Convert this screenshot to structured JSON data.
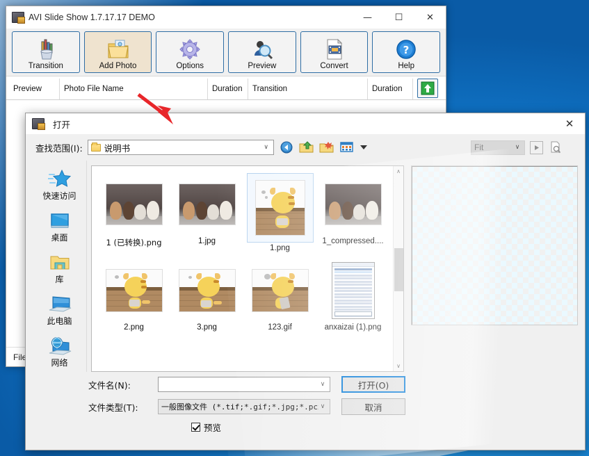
{
  "app": {
    "title": "AVI Slide Show 1.7.17.17 DEMO",
    "icon": "app-icon",
    "window_controls": {
      "minimize": "—",
      "maximize": "☐",
      "close": "✕"
    },
    "toolbar": [
      {
        "label": "Transition",
        "icon": "pencil-cup-icon",
        "active": false
      },
      {
        "label": "Add Photo",
        "icon": "add-photo-folder-icon",
        "active": true
      },
      {
        "label": "Options",
        "icon": "gear-icon",
        "active": false
      },
      {
        "label": "Preview",
        "icon": "magnifier-person-icon",
        "active": false
      },
      {
        "label": "Convert",
        "icon": "film-document-icon",
        "active": false
      },
      {
        "label": "Help",
        "icon": "question-mark-icon",
        "active": false
      }
    ],
    "columns": [
      "Preview",
      "Photo File Name",
      "Duration",
      "Transition",
      "Duration"
    ],
    "upload_button_icon": "green-up-arrow-icon",
    "status_text": "File"
  },
  "dialog": {
    "title": "打开",
    "icon": "app-icon",
    "close_label": "✕",
    "lookin_label": "查找范围(I):",
    "lookin_value": "说明书",
    "nav_icons": [
      "back-icon",
      "up-folder-icon",
      "new-folder-icon",
      "view-mode-icon",
      "view-mode-dropdown-icon"
    ],
    "fit_combo_value": "Fit",
    "play_button_icon": "play-icon",
    "zoom_button_icon": "page-zoom-icon",
    "places": [
      {
        "label": "快速访问",
        "icon": "star-quick-access-icon"
      },
      {
        "label": "桌面",
        "icon": "desktop-monitor-icon"
      },
      {
        "label": "库",
        "icon": "library-folder-icon"
      },
      {
        "label": "此电脑",
        "icon": "this-pc-icon"
      },
      {
        "label": "网络",
        "icon": "network-globe-icon"
      }
    ],
    "files": [
      {
        "name": "1 (已转换).png",
        "kind": "puppies",
        "selected": false
      },
      {
        "name": "1.jpg",
        "kind": "puppies",
        "selected": false
      },
      {
        "name": "1.png",
        "kind": "cat",
        "selected": true
      },
      {
        "name": "1_compressed....",
        "kind": "puppies",
        "selected": false
      },
      {
        "name": "2.png",
        "kind": "cat",
        "selected": false
      },
      {
        "name": "3.png",
        "kind": "cat",
        "selected": false
      },
      {
        "name": "123.gif",
        "kind": "cat",
        "selected": false
      },
      {
        "name": "anxaizai (1).png",
        "kind": "menu",
        "selected": false
      }
    ],
    "filename_label": "文件名(N):",
    "filename_value": "",
    "filetype_label": "文件类型(T):",
    "filetype_value": "一般图像文件 (*.tif;*.gif;*.jpg;*.pcx",
    "open_button": "打开(O)",
    "cancel_button": "取消",
    "preview_checkbox_label": "预览",
    "preview_checked": true,
    "scrollbar": {
      "up": "∧",
      "down": "∨"
    }
  },
  "annotation": {
    "arrow_color": "#e8262a"
  },
  "colors": {
    "accent": "#0078d7",
    "button_border": "#2e6da4",
    "active_tool_bg": "#efe3cf",
    "desktop": "#0f72c4"
  }
}
